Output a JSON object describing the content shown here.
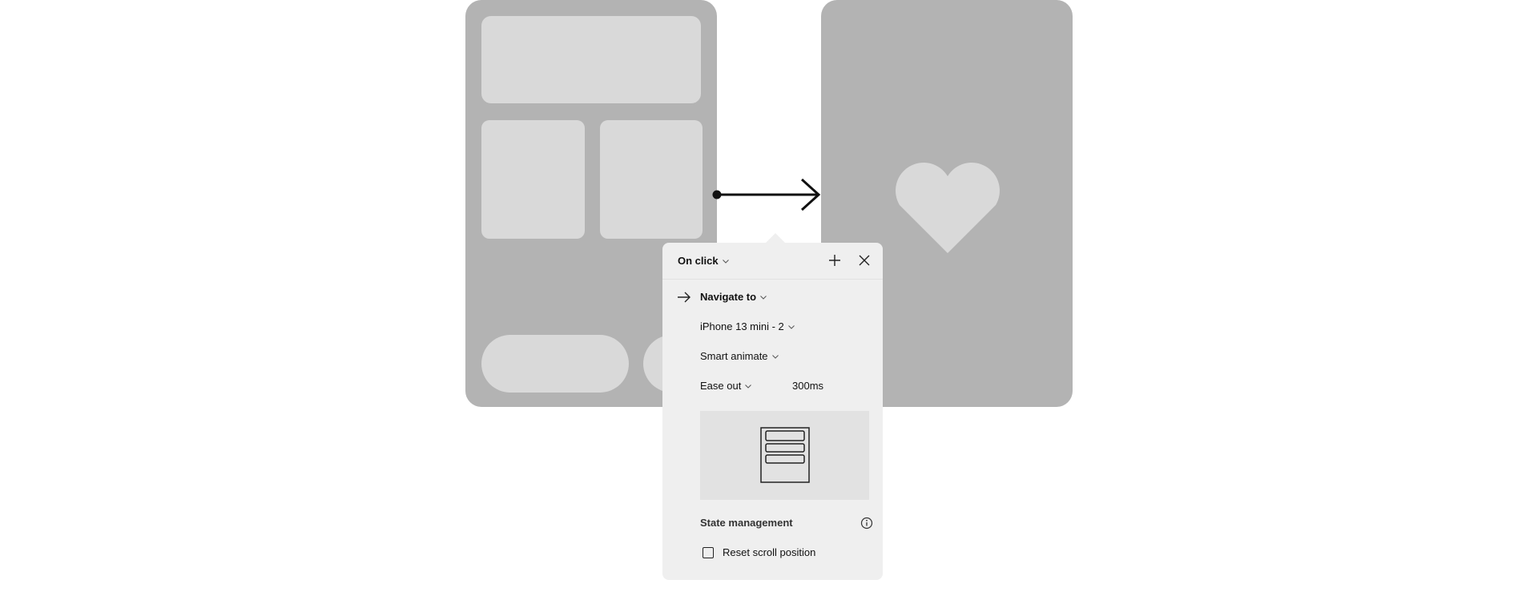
{
  "panel": {
    "trigger_label": "On click",
    "action_label": "Navigate to",
    "destination_label": "iPhone 13 mini - 2",
    "animation_label": "Smart animate",
    "easing_label": "Ease out",
    "duration_label": "300ms",
    "state_section_label": "State management",
    "reset_scroll_label": "Reset scroll position",
    "reset_scroll_checked": false
  },
  "icons": {
    "add": "plus-icon",
    "close": "close-icon",
    "action": "arrow-right-icon",
    "info": "info-icon",
    "dropdown": "chevron-down-icon",
    "destination_graphic": "heart-icon",
    "preview": "phone-layout-icon"
  },
  "colors": {
    "frame": "#b3b3b3",
    "placeholder": "#d9d9d9",
    "panel": "#efefef",
    "connector": "#111111"
  }
}
